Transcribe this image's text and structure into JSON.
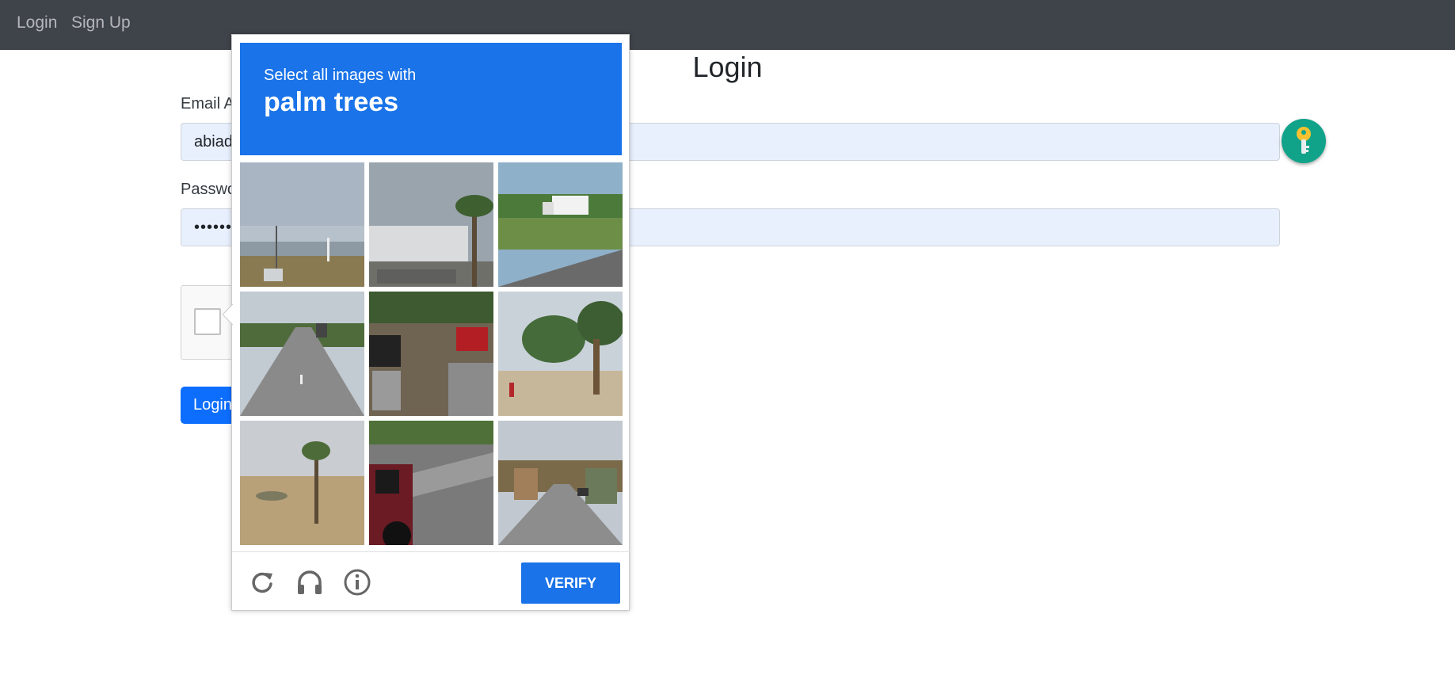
{
  "nav": {
    "login_link": "Login",
    "signup_link": "Sign Up"
  },
  "page": {
    "title": "Login"
  },
  "form": {
    "email_label": "Email A",
    "email_value": "abiad",
    "password_label": "Passwo",
    "password_value": "•••••••",
    "login_button_label": "Login"
  },
  "captcha": {
    "prompt": "Select all images with",
    "target": "palm trees",
    "verify_label": "VERIFY",
    "tiles": [
      {
        "id": "tile-1",
        "scene": "shoreline-power-lines"
      },
      {
        "id": "tile-2",
        "scene": "building-with-palm-tree"
      },
      {
        "id": "tile-3",
        "scene": "highway-with-truck"
      },
      {
        "id": "tile-4",
        "scene": "highway-road"
      },
      {
        "id": "tile-5",
        "scene": "street-with-parked-cars"
      },
      {
        "id": "tile-6",
        "scene": "palm-trees-sidewalk"
      },
      {
        "id": "tile-7",
        "scene": "single-palm-tree-field"
      },
      {
        "id": "tile-8",
        "scene": "red-jeep-road"
      },
      {
        "id": "tile-9",
        "scene": "town-street"
      }
    ],
    "icons": [
      "reload-icon",
      "audio-icon",
      "info-icon"
    ]
  },
  "colors": {
    "navbar": "#3f434a",
    "captcha_blue": "#1a73e8",
    "primary_button": "#0d6efd",
    "input_autofill": "#e8f0fe",
    "key_badge": "#11a38a"
  }
}
